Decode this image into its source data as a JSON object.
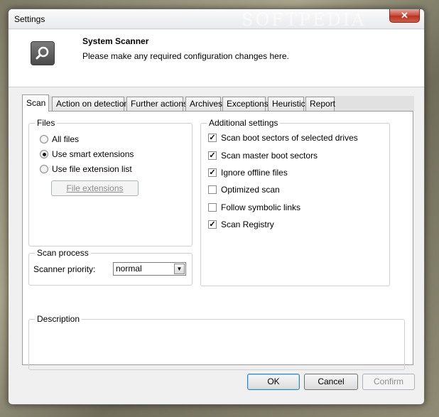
{
  "window": {
    "title": "Settings",
    "close_glyph": "✕"
  },
  "header": {
    "title": "System Scanner",
    "subtitle": "Please make any required configuration changes here.",
    "icon": "magnifier-icon"
  },
  "tabs": [
    {
      "label": "Scan",
      "active": true
    },
    {
      "label": "Action on detection",
      "active": false
    },
    {
      "label": "Further actions",
      "active": false
    },
    {
      "label": "Archives",
      "active": false
    },
    {
      "label": "Exceptions",
      "active": false
    },
    {
      "label": "Heuristic",
      "active": false
    },
    {
      "label": "Report",
      "active": false
    }
  ],
  "files": {
    "legend": "Files",
    "options": [
      {
        "label": "All files",
        "selected": false
      },
      {
        "label": "Use smart extensions",
        "selected": true
      },
      {
        "label": "Use file extension list",
        "selected": false
      }
    ],
    "extensions_button": "File extensions"
  },
  "scan_process": {
    "legend": "Scan process",
    "priority_label": "Scanner priority:",
    "priority_value": "normal"
  },
  "additional": {
    "legend": "Additional settings",
    "options": [
      {
        "label": "Scan boot sectors of selected drives",
        "checked": true
      },
      {
        "label": "Scan master boot sectors",
        "checked": true
      },
      {
        "label": "Ignore offline files",
        "checked": true
      },
      {
        "label": "Optimized scan",
        "checked": false
      },
      {
        "label": "Follow symbolic links",
        "checked": false
      },
      {
        "label": "Scan Registry",
        "checked": true
      }
    ]
  },
  "description": {
    "legend": "Description",
    "text": ""
  },
  "footer": {
    "ok": "OK",
    "cancel": "Cancel",
    "confirm": "Confirm"
  },
  "watermark": {
    "text": "SOFTPEDIA"
  },
  "colors": {
    "close_button": "#c6493a",
    "focus_border": "#3c7fb1"
  }
}
